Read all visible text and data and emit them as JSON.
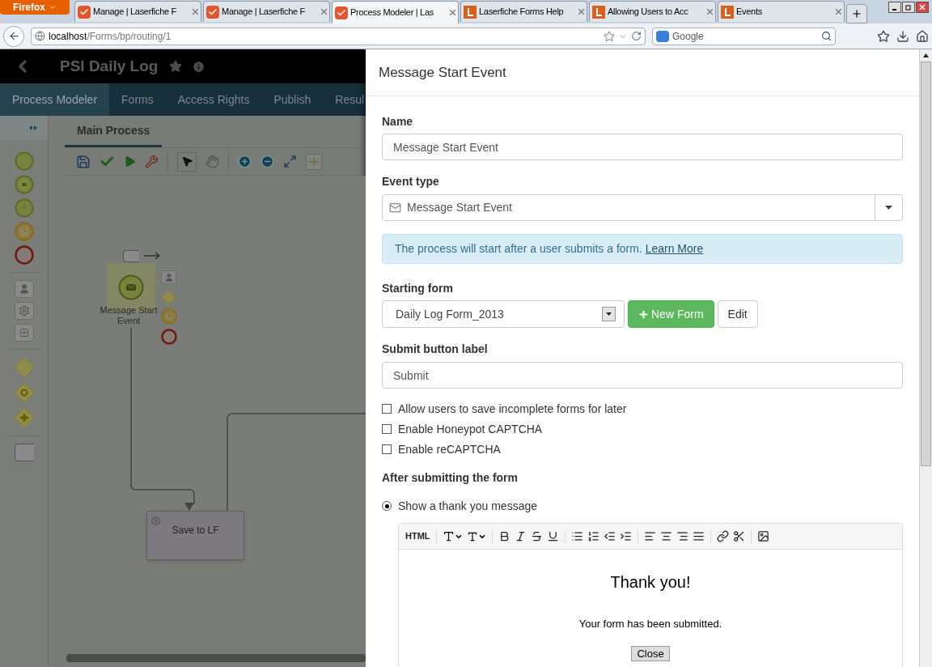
{
  "browser": {
    "menu_button": "Firefox",
    "tabs": [
      {
        "title": "Manage | Laserfiche F",
        "kind": "forms",
        "selected": false
      },
      {
        "title": "Manage | Laserfiche F",
        "kind": "forms",
        "selected": false
      },
      {
        "title": "Process Modeler | Las",
        "kind": "forms",
        "selected": true
      },
      {
        "title": "Laserfiche Forms Help",
        "kind": "help",
        "selected": false
      },
      {
        "title": "Allowing Users to Acc",
        "kind": "help",
        "selected": false
      },
      {
        "title": "Events",
        "kind": "help",
        "selected": false
      }
    ],
    "address_host": "localhost",
    "address_path": "/Forms/bp/routing/1",
    "search_placeholder": "Google"
  },
  "app": {
    "title": "PSI Daily Log",
    "nav": [
      {
        "label": "Process Modeler",
        "selected": true
      },
      {
        "label": "Forms",
        "selected": false
      },
      {
        "label": "Access Rights",
        "selected": false
      },
      {
        "label": "Publish",
        "selected": false
      },
      {
        "label": "Resul",
        "selected": false
      }
    ],
    "process_tab": "Main Process",
    "nodes": [
      {
        "kind": "message_start",
        "label": "Message Start Event"
      },
      {
        "kind": "task",
        "label": "Save to LF"
      }
    ]
  },
  "panel": {
    "title": "Message Start Event",
    "name_label": "Name",
    "name_value": "Message Start Event",
    "event_type_label": "Event type",
    "event_type_value": "Message Start Event",
    "info_text": "The process will start after a user submits a form.",
    "info_link": "Learn More",
    "starting_form_label": "Starting form",
    "starting_form_value": "Daily Log Form_2013",
    "new_form_button": "New Form",
    "edit_button": "Edit",
    "submit_label": "Submit button label",
    "submit_value": "Submit",
    "checkboxes": [
      {
        "label": "Allow users to save incomplete forms for later",
        "checked": false
      },
      {
        "label": "Enable Honeypot CAPTCHA",
        "checked": false
      },
      {
        "label": "Enable reCAPTCHA",
        "checked": false
      }
    ],
    "after_label": "After submitting the form",
    "options": [
      {
        "label": "Show a thank you message",
        "selected": true
      }
    ],
    "editor": {
      "html_button": "HTML",
      "heading": "Thank you!",
      "message": "Your form has been submitted.",
      "close_button": "Close"
    }
  }
}
